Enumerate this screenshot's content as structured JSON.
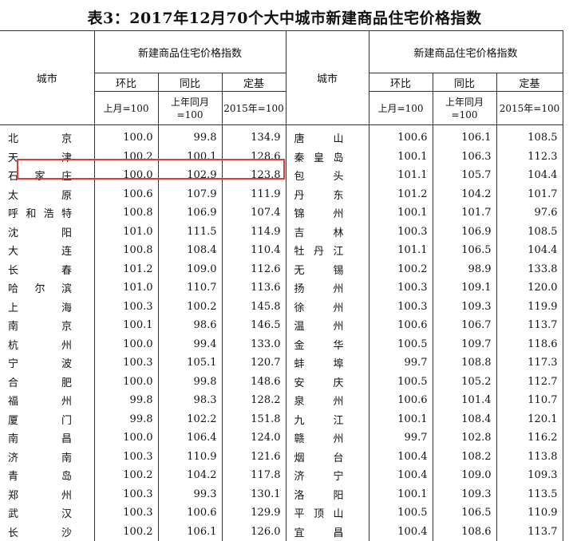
{
  "title": "表3：2017年12月70个大中城市新建商品住宅价格指数",
  "header": {
    "city": "城市",
    "group": "新建商品住宅价格指数",
    "cols": [
      "环比",
      "同比",
      "定基"
    ],
    "bases": [
      "上月=100",
      "上年同月=100",
      "2015年=100"
    ]
  },
  "highlight_color": "#e03a3a",
  "rows": [
    {
      "c1": "北京",
      "a": "100.0",
      "b": "99.8",
      "d": "134.9",
      "c2": "唐山",
      "e": "100.6",
      "f": "106.1",
      "g": "108.5"
    },
    {
      "c1": "天津",
      "a": "100.2",
      "b": "100.1",
      "d": "128.6",
      "c2": "秦皇岛",
      "e": "100.1",
      "f": "106.3",
      "g": "112.3"
    },
    {
      "c1": "石家庄",
      "a": "100.0",
      "b": "102.9",
      "d": "123.8",
      "c2": "包头",
      "e": "101.1",
      "f": "105.7",
      "g": "104.4"
    },
    {
      "c1": "太原",
      "a": "100.6",
      "b": "107.9",
      "d": "111.9",
      "c2": "丹东",
      "e": "101.2",
      "f": "104.2",
      "g": "101.7"
    },
    {
      "c1": "呼和浩特",
      "a": "100.8",
      "b": "106.9",
      "d": "107.4",
      "c2": "锦州",
      "e": "100.1",
      "f": "101.7",
      "g": "97.6"
    },
    {
      "c1": "沈阳",
      "a": "101.0",
      "b": "111.5",
      "d": "114.9",
      "c2": "吉林",
      "e": "100.3",
      "f": "106.9",
      "g": "108.5"
    },
    {
      "c1": "大连",
      "a": "100.8",
      "b": "108.4",
      "d": "110.4",
      "c2": "牡丹江",
      "e": "101.1",
      "f": "106.5",
      "g": "104.4"
    },
    {
      "c1": "长春",
      "a": "101.2",
      "b": "109.0",
      "d": "112.6",
      "c2": "无锡",
      "e": "100.2",
      "f": "98.9",
      "g": "133.8"
    },
    {
      "c1": "哈尔滨",
      "a": "101.0",
      "b": "110.7",
      "d": "113.6",
      "c2": "扬州",
      "e": "100.3",
      "f": "109.1",
      "g": "120.0"
    },
    {
      "c1": "上海",
      "a": "100.3",
      "b": "100.2",
      "d": "145.8",
      "c2": "徐州",
      "e": "100.3",
      "f": "109.3",
      "g": "119.9"
    },
    {
      "c1": "南京",
      "a": "100.1",
      "b": "98.6",
      "d": "146.5",
      "c2": "温州",
      "e": "100.6",
      "f": "106.7",
      "g": "113.7"
    },
    {
      "c1": "杭州",
      "a": "100.0",
      "b": "99.4",
      "d": "133.0",
      "c2": "金华",
      "e": "100.5",
      "f": "109.7",
      "g": "118.6"
    },
    {
      "c1": "宁波",
      "a": "100.3",
      "b": "105.1",
      "d": "120.7",
      "c2": "蚌埠",
      "e": "99.7",
      "f": "108.8",
      "g": "117.3"
    },
    {
      "c1": "合肥",
      "a": "100.0",
      "b": "99.8",
      "d": "148.6",
      "c2": "安庆",
      "e": "100.5",
      "f": "105.2",
      "g": "112.7"
    },
    {
      "c1": "福州",
      "a": "99.8",
      "b": "98.3",
      "d": "128.2",
      "c2": "泉州",
      "e": "100.6",
      "f": "101.4",
      "g": "110.7"
    },
    {
      "c1": "厦门",
      "a": "99.8",
      "b": "102.2",
      "d": "151.8",
      "c2": "九江",
      "e": "100.1",
      "f": "108.4",
      "g": "120.1"
    },
    {
      "c1": "南昌",
      "a": "100.0",
      "b": "106.4",
      "d": "124.0",
      "c2": "赣州",
      "e": "99.7",
      "f": "102.8",
      "g": "116.2"
    },
    {
      "c1": "济南",
      "a": "100.3",
      "b": "110.9",
      "d": "121.6",
      "c2": "烟台",
      "e": "100.4",
      "f": "108.2",
      "g": "113.8"
    },
    {
      "c1": "青岛",
      "a": "100.2",
      "b": "104.2",
      "d": "117.8",
      "c2": "济宁",
      "e": "100.4",
      "f": "109.0",
      "g": "109.3"
    },
    {
      "c1": "郑州",
      "a": "100.3",
      "b": "99.3",
      "d": "130.1",
      "c2": "洛阳",
      "e": "100.1",
      "f": "109.3",
      "g": "113.5"
    },
    {
      "c1": "武汉",
      "a": "100.3",
      "b": "100.6",
      "d": "129.9",
      "c2": "平顶山",
      "e": "100.5",
      "f": "106.5",
      "g": "110.9"
    },
    {
      "c1": "长沙",
      "a": "100.2",
      "b": "106.1",
      "d": "126.0",
      "c2": "宜昌",
      "e": "100.4",
      "f": "108.6",
      "g": "113.7"
    }
  ]
}
